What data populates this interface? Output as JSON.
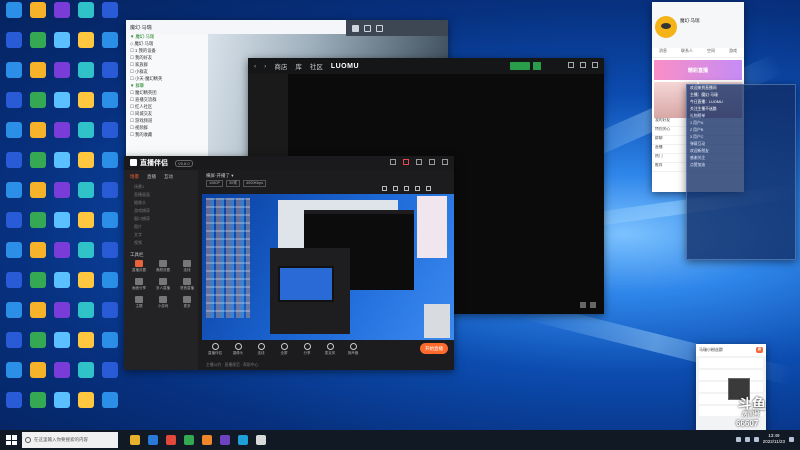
{
  "desktop": {
    "icon_colors": [
      "#2b8fe8",
      "#e84a3a",
      "#f6b32a",
      "#3cb371",
      "#7a3cd8",
      "#e05a8a",
      "#2fc2c8",
      "#d9d9d9",
      "#2a5bd7",
      "#f0862a",
      "#34a853",
      "#c43b2f",
      "#5bc0ff",
      "#8c8c8c",
      "#ffc640",
      "#1e6f3a"
    ]
  },
  "chat_window": {
    "title": "魔幻·马瑞",
    "sidebar_rows": [
      "▼ 魔幻·马瑞",
      "  ◇ 魔幻·马瑞",
      "  ☐ 1 我的设备",
      "  ☐ 我的好友",
      "  ☐ 家族群",
      "  ☐ 小群友",
      "  ☐ 小天·魔幻精英",
      "▼ 群聊",
      "  ☐ 魔幻精英团",
      "  ☐ 直播交流群",
      "  ☐ 红人社区",
      "  ☐ 同城交友",
      "  ☐ 游戏频道",
      "  ☐ 视频群",
      "  ☐ 我的收藏"
    ],
    "banner_text": "魔幻"
  },
  "video_window": {
    "nav": [
      "商店",
      "库",
      "社区"
    ],
    "brand": "LUOMU"
  },
  "stream_app": {
    "logo": "直播伴侣",
    "version": "V5.8.0",
    "tabs": [
      "场景",
      "直播",
      "互动"
    ],
    "sources": [
      "场景1",
      "直播画面",
      "摄像头",
      "游戏捕获",
      "窗口捕获",
      "图片",
      "文字",
      "视频"
    ],
    "tools_label": "工具栏",
    "tools": [
      "直播设置",
      "美颜设置",
      "连线",
      "画面分享",
      "多人直播",
      "语音直播",
      "主题",
      "小游戏",
      "更多"
    ],
    "topline": "横屏·开播了 ▾",
    "chips": [
      "1080P",
      "30帧",
      "4000Kbps"
    ],
    "bottom_buttons": [
      "直播伴侣",
      "摄像头",
      "连线",
      "全屏",
      "分享",
      "麦克风",
      "扬声器"
    ],
    "live_button": "开始直播",
    "footer": "主播公约 · 直播规范 · 帮助中心"
  },
  "side_panel": {
    "username": "魔幻·马瑞",
    "nav": [
      "消息",
      "联系人",
      "空间",
      "游戏"
    ],
    "promo": "精彩直播",
    "list": [
      "我的好友",
      "特别关心",
      "群聊",
      "直播",
      "热门",
      "推荐"
    ]
  },
  "overlay_panel": {
    "lines": [
      "欢迎来到直播间",
      "主播：魔幻·马瑞",
      "今日直播：LUOMU",
      "关注主播不迷路",
      "礼物榜单",
      "1 用户A",
      "2 用户B",
      "3 用户C",
      "弹幕互动",
      "欢迎新朋友",
      "感谢关注",
      "点赞加油"
    ]
  },
  "small_chat": {
    "title": "马瑞小粉丝群",
    "badge": "群"
  },
  "douyu": {
    "logo": "斗鱼",
    "room_label": "房间号",
    "room_number": "66607"
  },
  "taskbar": {
    "search_placeholder": "在这里输入你要搜索的内容",
    "app_colors": [
      "#e7b12d",
      "#2a78d8",
      "#e14a3a",
      "#34a853",
      "#f0862a",
      "#6f42c1",
      "#1ea0d8",
      "#d9d9d9"
    ],
    "time": "13:49",
    "date": "2022/11/23"
  }
}
